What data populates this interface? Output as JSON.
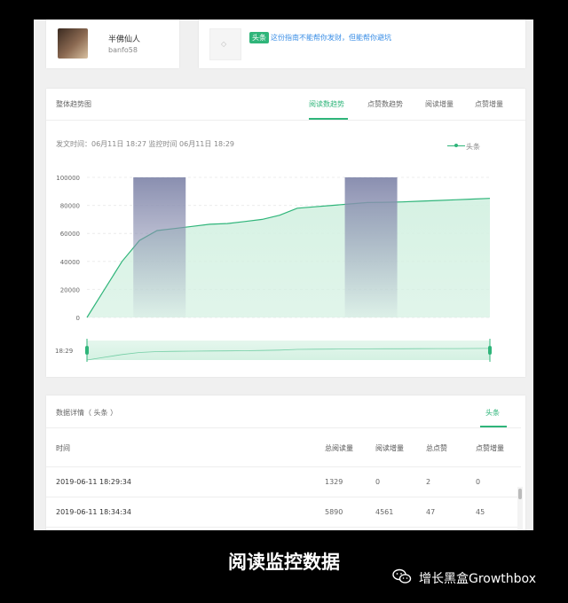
{
  "author": {
    "name": "半佛仙人",
    "id": "banfo58"
  },
  "article": {
    "badge": "头条",
    "title": "这份指南不能帮你发财，但能帮你避坑"
  },
  "trend": {
    "title": "整体趋势图",
    "tabs": [
      "阅读数趋势",
      "点赞数趋势",
      "阅读增量",
      "点赞增量"
    ],
    "active_tab": 0,
    "meta": "发文时间：06月11日 18:27 监控时间 06月11日 18:29",
    "legend": "头条",
    "slider_start": "18:29"
  },
  "chart_data": {
    "type": "area",
    "y_ticks": [
      "100000",
      "80000",
      "60000",
      "40000",
      "20000",
      "0"
    ],
    "ylim": [
      0,
      100000
    ],
    "series": [
      {
        "name": "头条",
        "values": [
          0,
          20000,
          40000,
          55000,
          62000,
          63500,
          65000,
          66500,
          67000,
          68500,
          70000,
          73000,
          78000,
          79000,
          80000,
          81000,
          82000,
          82200,
          82500,
          83000,
          83500,
          84000,
          84500,
          85000
        ]
      }
    ],
    "highlight_bands": [
      [
        0.115,
        0.245
      ],
      [
        0.64,
        0.77
      ]
    ],
    "colors": {
      "line": "#2fb57a",
      "fill": "#d4f1e2",
      "band": "#8a8fb0"
    }
  },
  "details": {
    "title": "数据详情（ 头条 ）",
    "tab": "头条",
    "columns": [
      "时间",
      "总阅读量",
      "阅读增量",
      "总点赞",
      "点赞增量"
    ],
    "rows": [
      [
        "2019-06-11 18:29:34",
        "1329",
        "0",
        "2",
        "0"
      ],
      [
        "2019-06-11 18:34:34",
        "5890",
        "4561",
        "47",
        "45"
      ]
    ]
  },
  "caption": "阅读监控数据",
  "brand": "增长黑盒Growthbox"
}
